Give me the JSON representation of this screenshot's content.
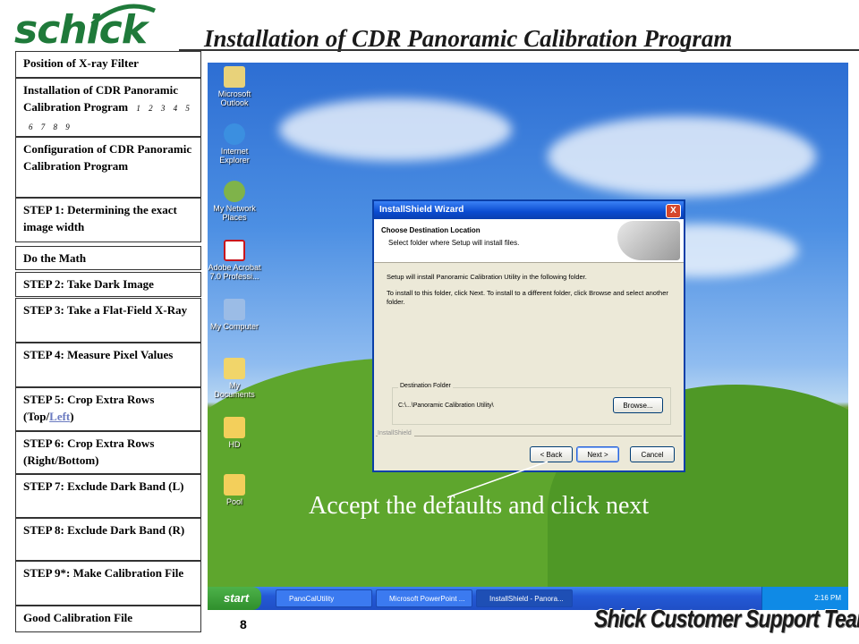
{
  "brand": {
    "logo_text": "schick",
    "logo_color": "#1f7a3a"
  },
  "header": {
    "title": "Installation of CDR Panoramic Calibration Program"
  },
  "nav": {
    "items": [
      {
        "label": "Position of X-ray Filter"
      },
      {
        "label": "Installation of CDR Panoramic Calibration Program",
        "sub_numbers": [
          "1",
          "2",
          "3",
          "4",
          "5",
          "6",
          "7",
          "8",
          "9"
        ]
      },
      {
        "label": "Configuration of CDR Panoramic Calibration Program"
      },
      {
        "label": "STEP 1: Determining the exact image width"
      },
      {
        "label": "Do the Math"
      },
      {
        "label": "STEP 2: Take Dark Image"
      },
      {
        "label": "STEP 3: Take a Flat-Field X-Ray"
      },
      {
        "label": "STEP 4: Measure Pixel Values"
      },
      {
        "label_prefix": "STEP 5: Crop Extra Rows (Top/",
        "label_link": "Left",
        "label_suffix": ")"
      },
      {
        "label": "STEP 6: Crop Extra Rows (Right/Bottom)"
      },
      {
        "label": "STEP 7: Exclude Dark Band (L)"
      },
      {
        "label": "STEP 8: Exclude Dark Band (R)"
      },
      {
        "label": "STEP 9*: Make Calibration File"
      },
      {
        "label": "Good Calibration File"
      }
    ]
  },
  "desktop": {
    "icons": [
      {
        "label": "Microsoft Outlook",
        "icon": "outlook-icon"
      },
      {
        "label": "Internet Explorer",
        "icon": "ie-icon"
      },
      {
        "label": "My Network Places",
        "icon": "network-icon"
      },
      {
        "label": "Adobe Acrobat 7.0 Professi...",
        "icon": "acrobat-icon"
      },
      {
        "label": "My Computer",
        "icon": "computer-icon"
      },
      {
        "label": "My Documents",
        "icon": "documents-icon"
      },
      {
        "label": "HD",
        "icon": "folder-icon"
      },
      {
        "label": "Pool",
        "icon": "folder-icon"
      }
    ]
  },
  "dialog": {
    "title": "InstallShield Wizard",
    "close": "X",
    "heading": "Choose Destination Location",
    "subheading": "Select folder where Setup will install files.",
    "body1": "Setup will install Panoramic Calibration Utility in the following folder.",
    "body2": "To install to this folder, click Next. To install to a different folder, click Browse and select another folder.",
    "dest_legend": "Destination Folder",
    "dest_path": "C:\\...\\Panoramic Calibration Utility\\",
    "browse": "Browse...",
    "brand_footer": "InstallShield",
    "back": "< Back",
    "next": "Next >",
    "cancel": "Cancel"
  },
  "callout": {
    "text": "Accept the defaults and click next"
  },
  "taskbar": {
    "start": "start",
    "items": [
      {
        "label": "PanoCalUtility"
      },
      {
        "label": "Microsoft PowerPoint ..."
      },
      {
        "label": "InstallShield - Panora..."
      }
    ],
    "time": "2:16 PM"
  },
  "footer": {
    "page_number": "8",
    "team": "Shick Customer Support Team"
  }
}
